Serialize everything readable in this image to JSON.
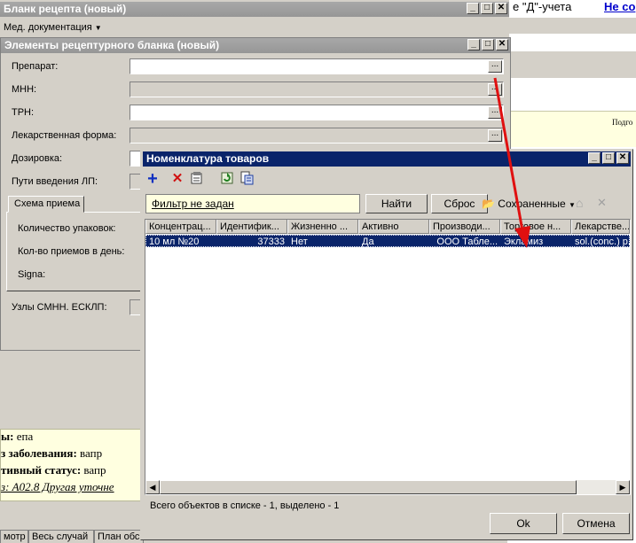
{
  "bg": {
    "top_text": "е \"Д\"-учета",
    "top_link": "Не со",
    "podg": "Подго",
    "line1_bold": "ы:",
    "line1": " епа",
    "line2_bold": "з заболевания:",
    "line2": " вапр",
    "line3_bold": "тивный статус:",
    "line3": " вапр",
    "line4": "з: А02.8 Другая уточне",
    "tabs": [
      "мотр",
      "Весь случай",
      "План обс"
    ]
  },
  "win_blank": {
    "title": "Бланк рецепта (новый)",
    "menu": "Мед. документация"
  },
  "win_elements": {
    "title": "Элементы рецептурного бланка (новый)",
    "labels": {
      "drug": "Препарат:",
      "mnn": "МНН:",
      "trn": "ТРН:",
      "form": "Лекарственная форма:",
      "dose": "Дозировка:",
      "route": "Пути введения ЛП:"
    },
    "tab": "Схема приема",
    "scheme": {
      "packs": "Количество упаковок:",
      "intakes": "Кол-во приемов в день:",
      "signa": "Signa:"
    },
    "nodes": "Узлы СМНН. ЕСКЛП:"
  },
  "win_nomen": {
    "title": "Номенклатура товаров",
    "filter": "Фильтр не задан",
    "find": "Найти",
    "reset": "Сброс",
    "saved": "Сохраненные",
    "columns": [
      "Концентрац...",
      "Идентифик...",
      "Жизненно ...",
      "Активно",
      "Производи...",
      "Торговое н...",
      "Лекарстве..."
    ],
    "row": [
      "10 мл №20",
      "37333",
      "Нет",
      "Да",
      "ООО Табле...",
      "Экламиз",
      "sol.(conc.) p."
    ],
    "status": "Всего объектов в списке - 1, выделено - 1",
    "ok": "Ok",
    "cancel": "Отмена"
  }
}
